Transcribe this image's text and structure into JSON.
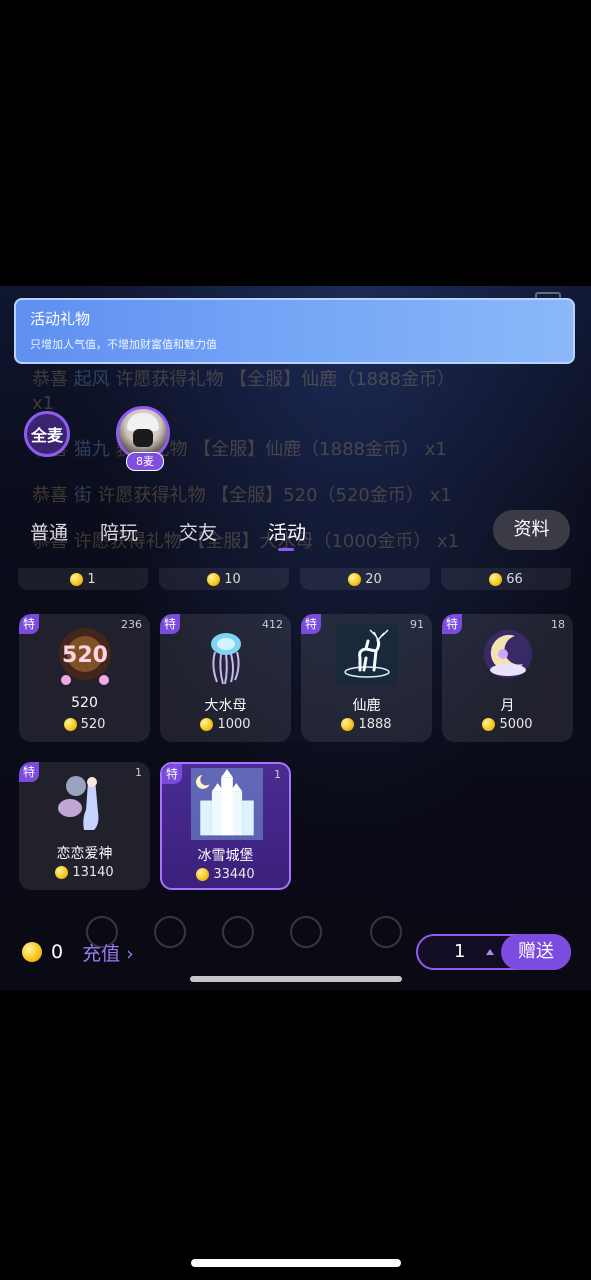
{
  "banner": {
    "title": "活动礼物",
    "subtitle": "只增加人气值，不增加财富值和魅力值"
  },
  "chat_background": [
    {
      "prefix": "恭喜 ",
      "nick": "起风",
      "text": " 许愿获得礼物 【全服】仙鹿（1888金币） x1"
    },
    {
      "prefix": "恭喜 ",
      "nick": "猫九",
      "text": " 获得礼物 【全服】仙鹿（1888金币） x1"
    },
    {
      "prefix": "恭喜 ",
      "nick": "街",
      "text": " 许愿获得礼物 【全服】520（520金币） x1"
    },
    {
      "prefix": "恭喜 ",
      "nick": "",
      "text": " 许愿获得礼物 【全服】大水母（1000金币） x1"
    }
  ],
  "mic": {
    "all_mic_label": "全麦",
    "seat_badge": "8麦"
  },
  "tabs": [
    {
      "label": "普通",
      "active": false
    },
    {
      "label": "陪玩",
      "active": false
    },
    {
      "label": "交友",
      "active": false
    },
    {
      "label": "活动",
      "active": true
    }
  ],
  "profile_button": "资料",
  "prev_row_prices": [
    "1",
    "10",
    "20",
    "66"
  ],
  "gifts": [
    {
      "name": "520",
      "price": "520",
      "count": "236",
      "tag": "特",
      "icon": "hearts-520-icon",
      "selected": false
    },
    {
      "name": "大水母",
      "price": "1000",
      "count": "412",
      "tag": "特",
      "icon": "jellyfish-icon",
      "selected": false
    },
    {
      "name": "仙鹿",
      "price": "1888",
      "count": "91",
      "tag": "特",
      "icon": "deer-icon",
      "selected": false
    },
    {
      "name": "月",
      "price": "5000",
      "count": "18",
      "tag": "特",
      "icon": "moon-icon",
      "selected": false
    },
    {
      "name": "恋恋爱神",
      "price": "13140",
      "count": "1",
      "tag": "特",
      "icon": "cupid-icon",
      "selected": false
    },
    {
      "name": "冰雪城堡",
      "price": "33440",
      "count": "1",
      "tag": "特",
      "icon": "ice-castle-icon",
      "selected": true
    }
  ],
  "bottom": {
    "balance": "0",
    "recharge_label": "充值 ›",
    "quantity": "1",
    "send_label": "赠送"
  },
  "colors": {
    "accent": "#8f5cf0",
    "send": "#7c4ce0",
    "banner": "#77a8f7",
    "coin": "#f7c81e"
  }
}
